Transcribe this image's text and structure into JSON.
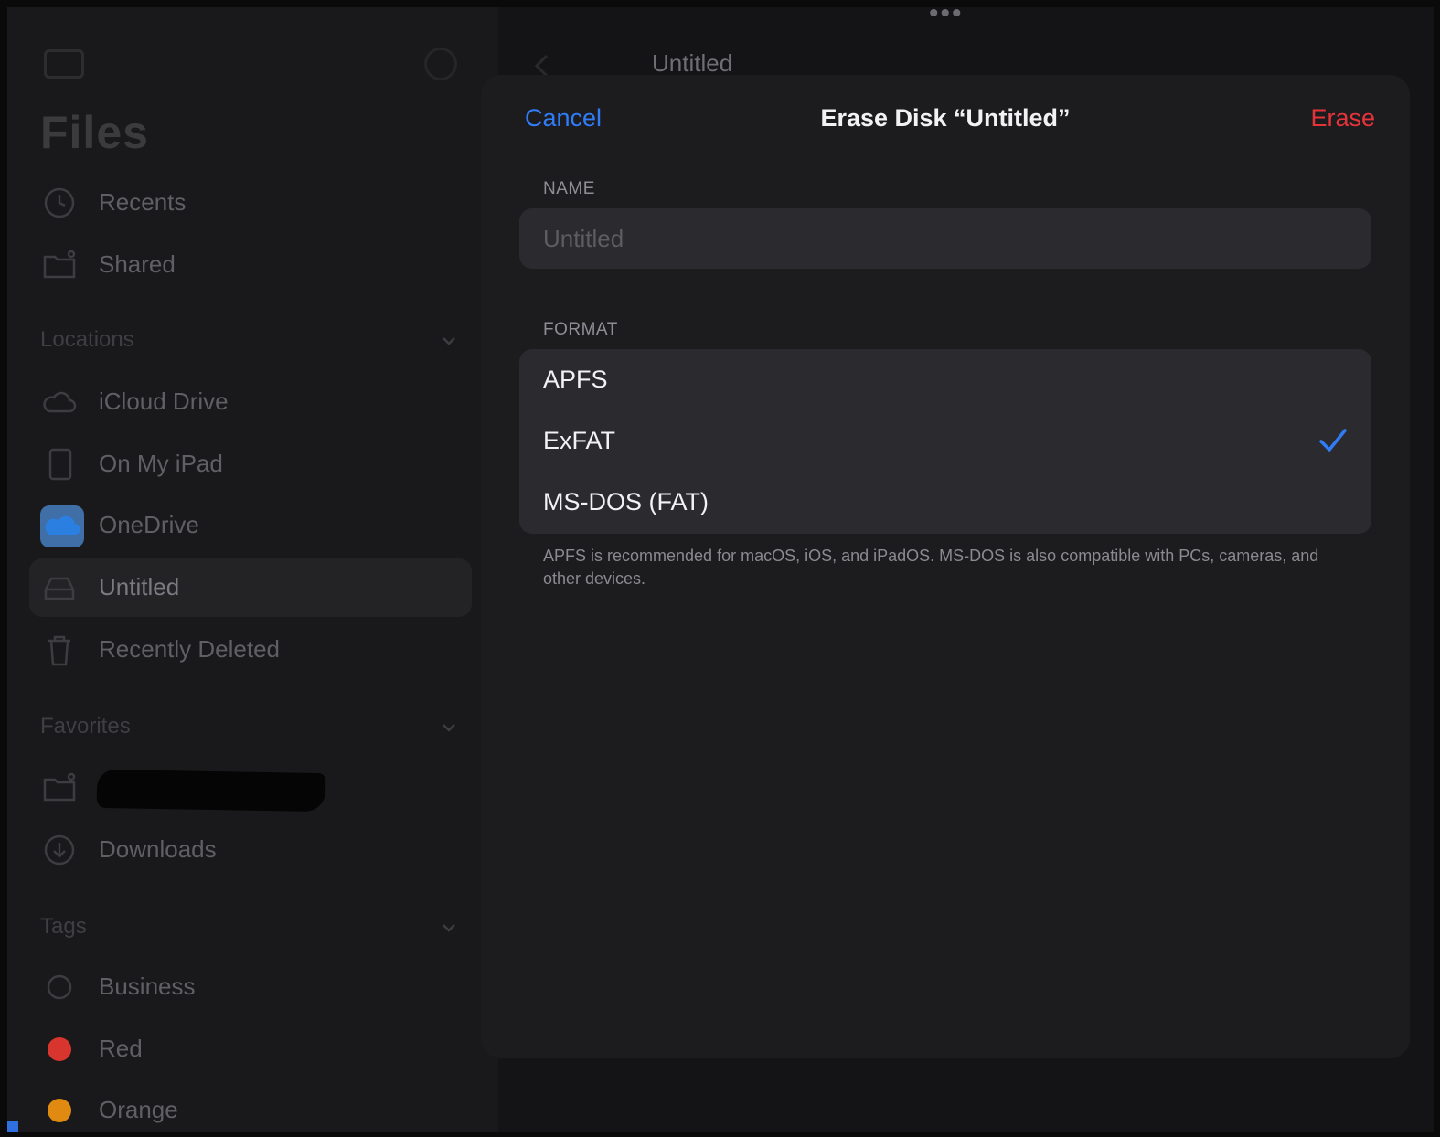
{
  "sidebar": {
    "title": "Files",
    "items": [
      {
        "label": "Recents",
        "icon": "clock-icon"
      },
      {
        "label": "Shared",
        "icon": "shared-folder-icon"
      }
    ],
    "locations": {
      "header": "Locations",
      "items": [
        {
          "label": "iCloud Drive",
          "icon": "cloud-icon"
        },
        {
          "label": "On My iPad",
          "icon": "ipad-icon"
        },
        {
          "label": "OneDrive",
          "icon": "onedrive-icon"
        },
        {
          "label": "Untitled",
          "icon": "external-drive-icon",
          "selected": true
        },
        {
          "label": "Recently Deleted",
          "icon": "trash-icon"
        }
      ]
    },
    "favorites": {
      "header": "Favorites",
      "items": [
        {
          "label": "",
          "icon": "shared-folder-icon",
          "redacted": true
        },
        {
          "label": "Downloads",
          "icon": "download-icon"
        }
      ]
    },
    "tags": {
      "header": "Tags",
      "items": [
        {
          "label": "Business",
          "color": ""
        },
        {
          "label": "Red",
          "color": "#d8352f"
        },
        {
          "label": "Orange",
          "color": "#e08a12"
        }
      ]
    }
  },
  "main": {
    "title": "Untitled"
  },
  "modal": {
    "cancel_label": "Cancel",
    "title": "Erase Disk “Untitled”",
    "erase_label": "Erase",
    "name_header": "NAME",
    "name_placeholder": "Untitled",
    "name_value": "",
    "format_header": "FORMAT",
    "formats": [
      {
        "label": "APFS",
        "selected": false
      },
      {
        "label": "ExFAT",
        "selected": true
      },
      {
        "label": "MS-DOS (FAT)",
        "selected": false
      }
    ],
    "footer": "APFS is recommended for macOS, iOS, and iPadOS. MS-DOS is also compatible with PCs, cameras, and other devices."
  },
  "colors": {
    "accent": "#2f7cf6",
    "destructive": "#e5333a",
    "background": "#141416",
    "sheet": "#1c1c1f"
  }
}
